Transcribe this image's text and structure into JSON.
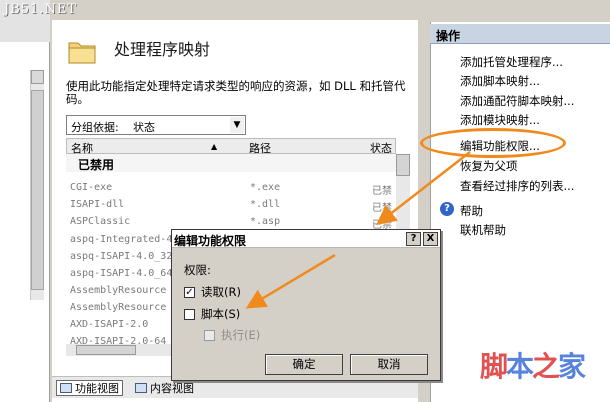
{
  "watermark_top": "JB51.NET",
  "page": {
    "title": "处理程序映射",
    "description": "使用此功能指定处理特定请求类型的响应的资源，如 DLL 和托管代码。",
    "group_by_label": "分组依据:",
    "group_by_value": "状态",
    "columns": [
      "名称",
      "路径",
      "状态"
    ],
    "group_header": "已禁用",
    "rows": [
      {
        "name": "CGI-exe",
        "path": "*.exe",
        "state": "已禁"
      },
      {
        "name": "ISAPI-dll",
        "path": "*.dll",
        "state": "已禁"
      },
      {
        "name": "ASPClassic",
        "path": "*.asp",
        "state": "已禁"
      },
      {
        "name": "aspq-Integrated-4",
        "path": "",
        "state": ""
      },
      {
        "name": "aspq-ISAPI-4.0_32",
        "path": "",
        "state": ""
      },
      {
        "name": "aspq-ISAPI-4.0_64",
        "path": "",
        "state": ""
      },
      {
        "name": "AssemblyResource",
        "path": "",
        "state": ""
      },
      {
        "name": "AssemblyResource",
        "path": "",
        "state": ""
      },
      {
        "name": "AXD-ISAPI-2.0",
        "path": "",
        "state": ""
      },
      {
        "name": "AXD-ISAPI-2.0-64",
        "path": "",
        "state": ""
      }
    ]
  },
  "view_tabs": {
    "features": "功能视图",
    "content": "内容视图"
  },
  "actions": {
    "header": "操作",
    "items": [
      "添加托管处理程序...",
      "添加脚本映射...",
      "添加通配符脚本映射...",
      "添加模块映射...",
      "编辑功能权限...",
      "恢复为父项",
      "查看经过排序的列表..."
    ],
    "help": "帮助",
    "online_help": "联机帮助"
  },
  "dialog": {
    "title": "编辑功能权限",
    "help_btn": "?",
    "close_btn": "X",
    "label": "权限:",
    "read": "读取(R)",
    "script": "脚本(S)",
    "execute": "执行(E)",
    "ok": "确定",
    "cancel": "取消",
    "read_checked": true,
    "script_checked": false,
    "execute_checked": false
  },
  "watermark": {
    "part1": "脚",
    "part2": "本",
    "part3": "之",
    "part4": "家"
  },
  "colors": {
    "annotation": "#f08a1c",
    "actions_header": "#c9d4e2"
  }
}
